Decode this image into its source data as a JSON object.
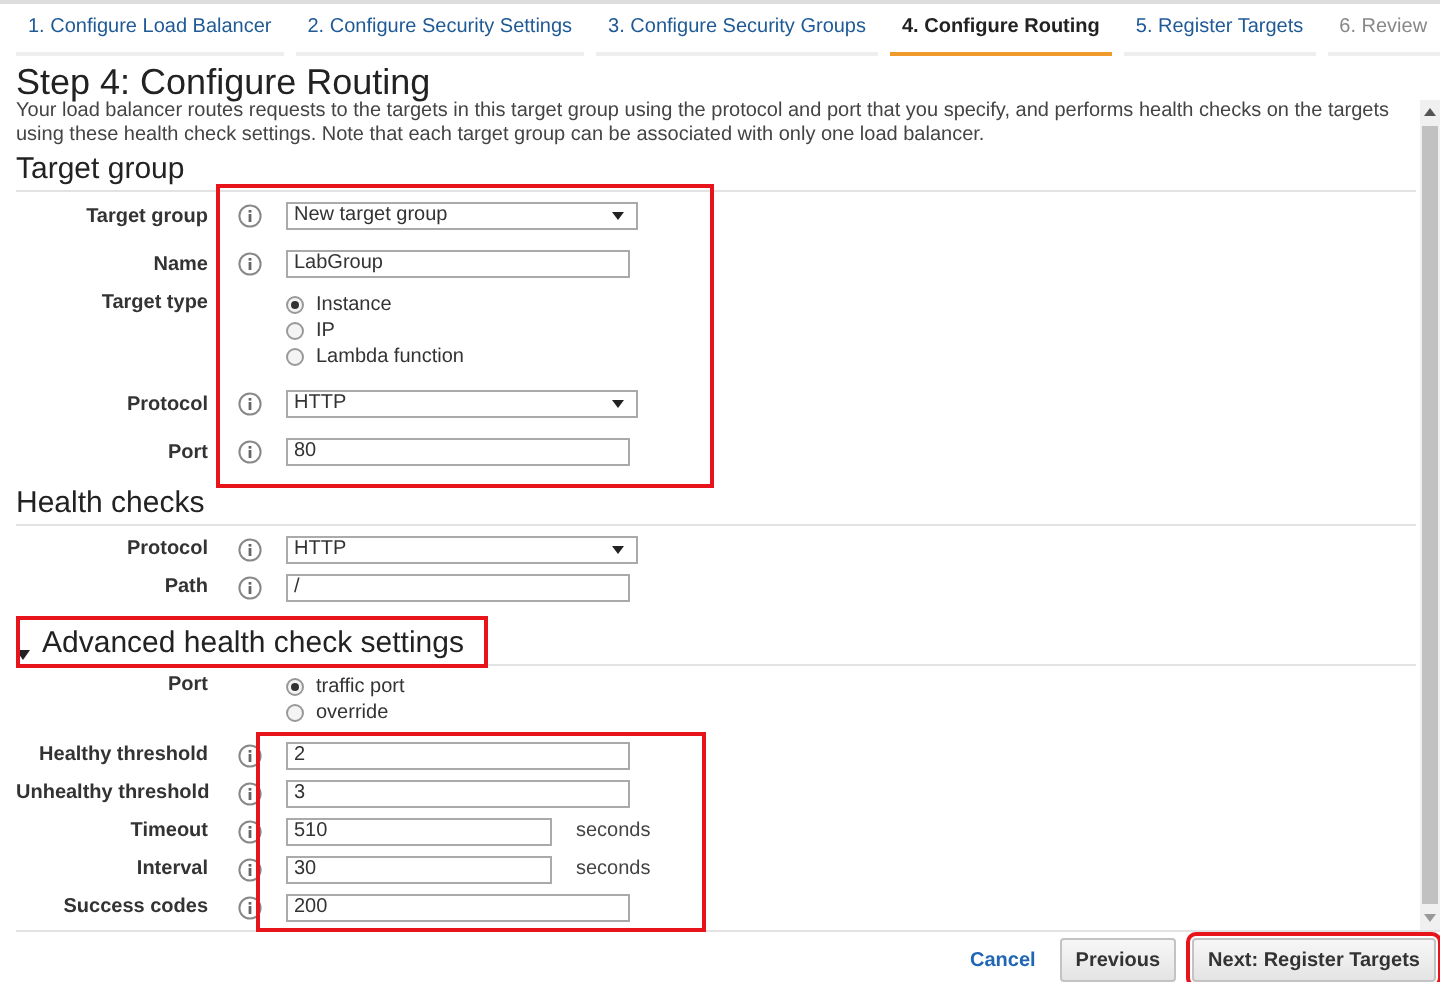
{
  "steps": [
    {
      "label": "1. Configure Load Balancer",
      "selected": false,
      "disabled": false
    },
    {
      "label": "2. Configure Security Settings",
      "selected": false,
      "disabled": false
    },
    {
      "label": "3. Configure Security Groups",
      "selected": false,
      "disabled": false
    },
    {
      "label": "4. Configure Routing",
      "selected": true,
      "disabled": false
    },
    {
      "label": "5. Register Targets",
      "selected": false,
      "disabled": false
    },
    {
      "label": "6. Review",
      "selected": false,
      "disabled": true
    }
  ],
  "title": "Step 4: Configure Routing",
  "description": "Your load balancer routes requests to the targets in this target group using the protocol and port that you specify, and performs health checks on the targets using these health check settings. Note that each target group can be associated with only one load balancer.",
  "sections": [
    {
      "title": "Target group",
      "kind": "heading",
      "fields": [
        {
          "kind": "select",
          "label": "Target group",
          "value": "New target group"
        },
        {
          "kind": "text",
          "label": "Name",
          "value": "LabGroup"
        },
        {
          "kind": "radio",
          "label": "Target type",
          "options": [
            {
              "label": "Instance",
              "selected": true
            },
            {
              "label": "IP",
              "selected": false
            },
            {
              "label": "Lambda function",
              "selected": false
            }
          ]
        },
        {
          "kind": "select",
          "label": "Protocol",
          "value": "HTTP"
        },
        {
          "kind": "text",
          "label": "Port",
          "value": "80"
        }
      ]
    },
    {
      "title": "Health checks",
      "kind": "heading",
      "fields": [
        {
          "kind": "select",
          "label": "Protocol",
          "value": "HTTP"
        },
        {
          "kind": "text",
          "label": "Path",
          "value": "/"
        }
      ]
    },
    {
      "title": "Advanced health check settings",
      "kind": "toggle",
      "expanded": true,
      "fields": [
        {
          "kind": "radio",
          "label": "Port",
          "options": [
            {
              "label": "traffic port",
              "selected": true
            },
            {
              "label": "override",
              "selected": false
            }
          ]
        },
        {
          "kind": "text",
          "label": "Healthy threshold",
          "value": "2"
        },
        {
          "kind": "text",
          "label": "Unhealthy threshold",
          "value": "3"
        },
        {
          "kind": "short",
          "label": "Timeout",
          "value": "510",
          "unit": "seconds"
        },
        {
          "kind": "short",
          "label": "Interval",
          "value": "30",
          "unit": "seconds"
        },
        {
          "kind": "text",
          "label": "Success codes",
          "value": "200"
        }
      ]
    }
  ],
  "footer": {
    "cancel": "Cancel",
    "previous": "Previous",
    "next": "Next: Register Targets"
  }
}
